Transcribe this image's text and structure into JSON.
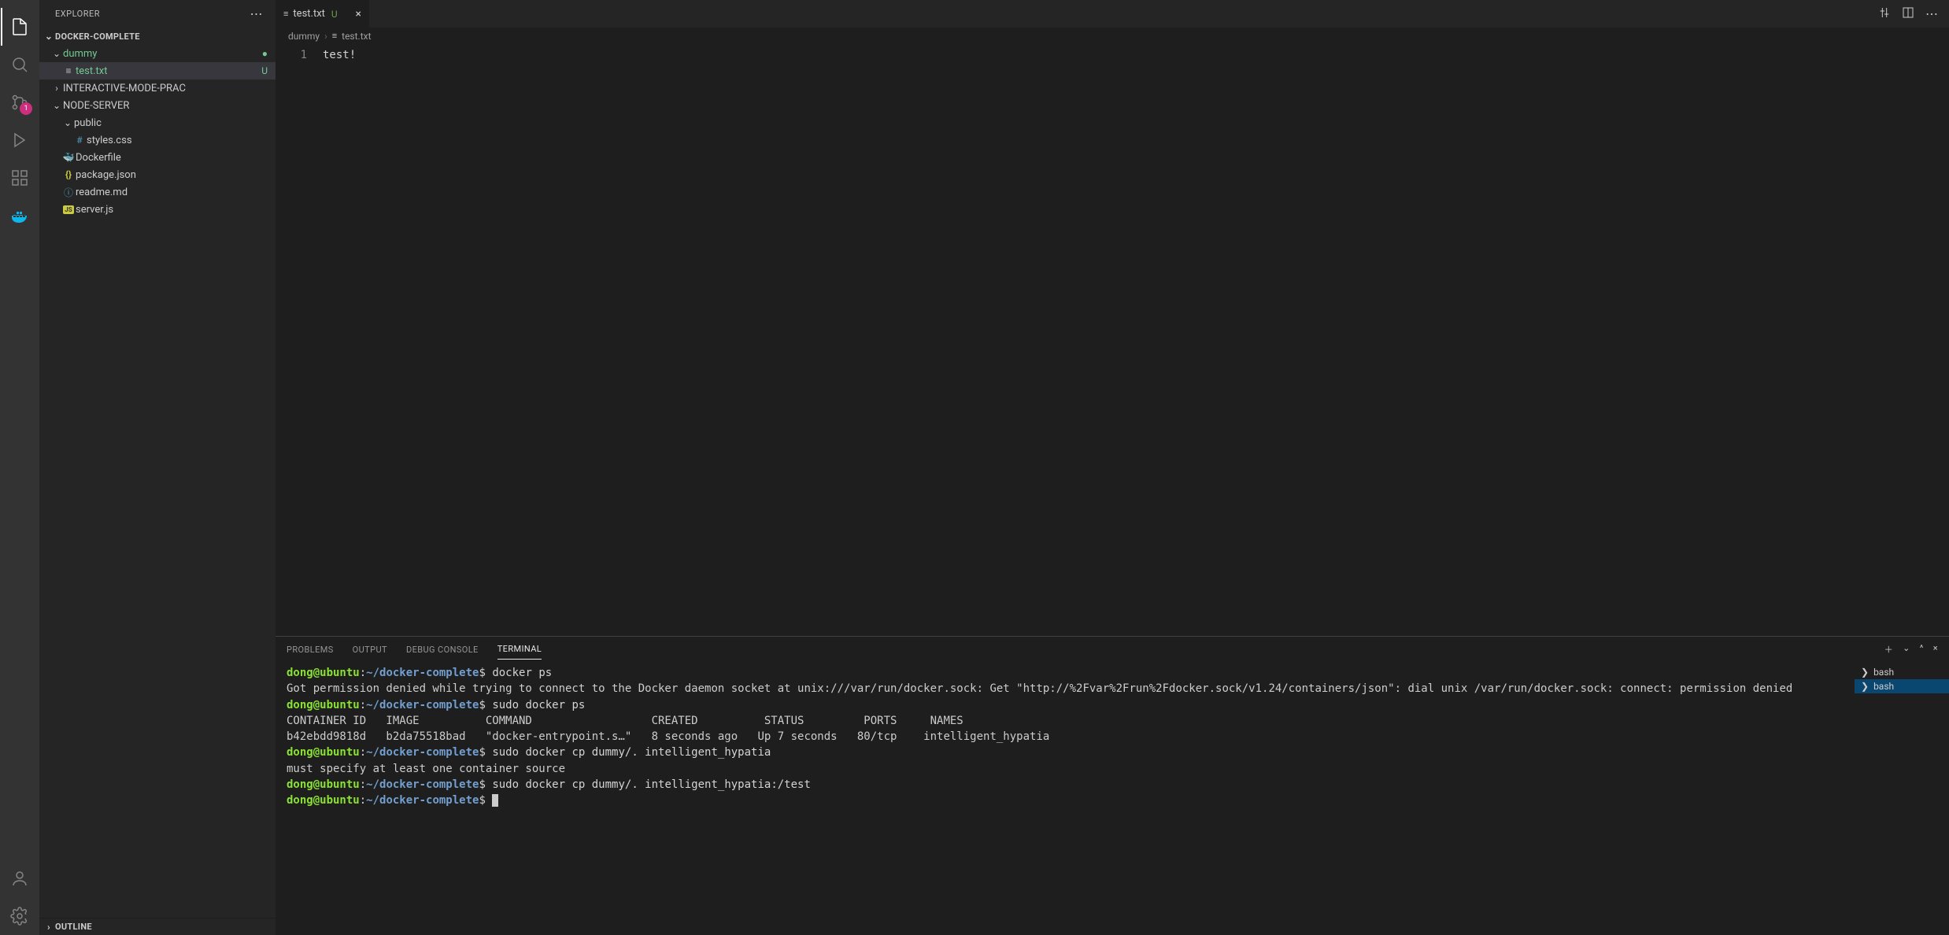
{
  "explorer": {
    "title": "EXPLORER",
    "project": "DOCKER-COMPLETE",
    "outline": "OUTLINE"
  },
  "tree": {
    "dummy": {
      "label": "dummy",
      "status": "●"
    },
    "testtxt": {
      "label": "test.txt",
      "status": "U"
    },
    "interactive": {
      "label": "INTERACTIVE-MODE-PRAC"
    },
    "nodeserver": {
      "label": "NODE-SERVER"
    },
    "public": {
      "label": "public"
    },
    "stylescss": {
      "label": "styles.css"
    },
    "dockerfile": {
      "label": "Dockerfile"
    },
    "packagejson": {
      "label": "package.json"
    },
    "readme": {
      "label": "readme.md"
    },
    "serverjs": {
      "label": "server.js"
    }
  },
  "scm_badge": "1",
  "tab": {
    "label": "test.txt",
    "status": "U"
  },
  "breadcrumbs": {
    "folder": "dummy",
    "file": "test.txt"
  },
  "editor": {
    "line1_num": "1",
    "line1": "test!"
  },
  "panel_tabs": {
    "problems": "PROBLEMS",
    "output": "OUTPUT",
    "debug": "DEBUG CONSOLE",
    "terminal": "TERMINAL"
  },
  "terminal_list": {
    "item1": "bash",
    "item2": "bash"
  },
  "term": {
    "prompt_user": "dong@ubuntu",
    "prompt_path": "~/docker-complete",
    "cmd1": " docker ps",
    "out1": "Got permission denied while trying to connect to the Docker daemon socket at unix:///var/run/docker.sock: Get \"http://%2Fvar%2Frun%2Fdocker.sock/v1.24/containers/json\": dial unix /var/run/docker.sock: connect: permission denied",
    "cmd2": " sudo docker ps",
    "ps_header": "CONTAINER ID   IMAGE          COMMAND                  CREATED          STATUS         PORTS     NAMES",
    "ps_row": "b42ebdd9818d   b2da75518bad   \"docker-entrypoint.s…\"   8 seconds ago   Up 7 seconds   80/tcp    intelligent_hypatia",
    "cmd3": " sudo docker cp dummy/. intelligent_hypatia",
    "out3": "must specify at least one container source",
    "cmd4": " sudo docker cp dummy/. intelligent_hypatia:/test",
    "cmd5": " "
  }
}
